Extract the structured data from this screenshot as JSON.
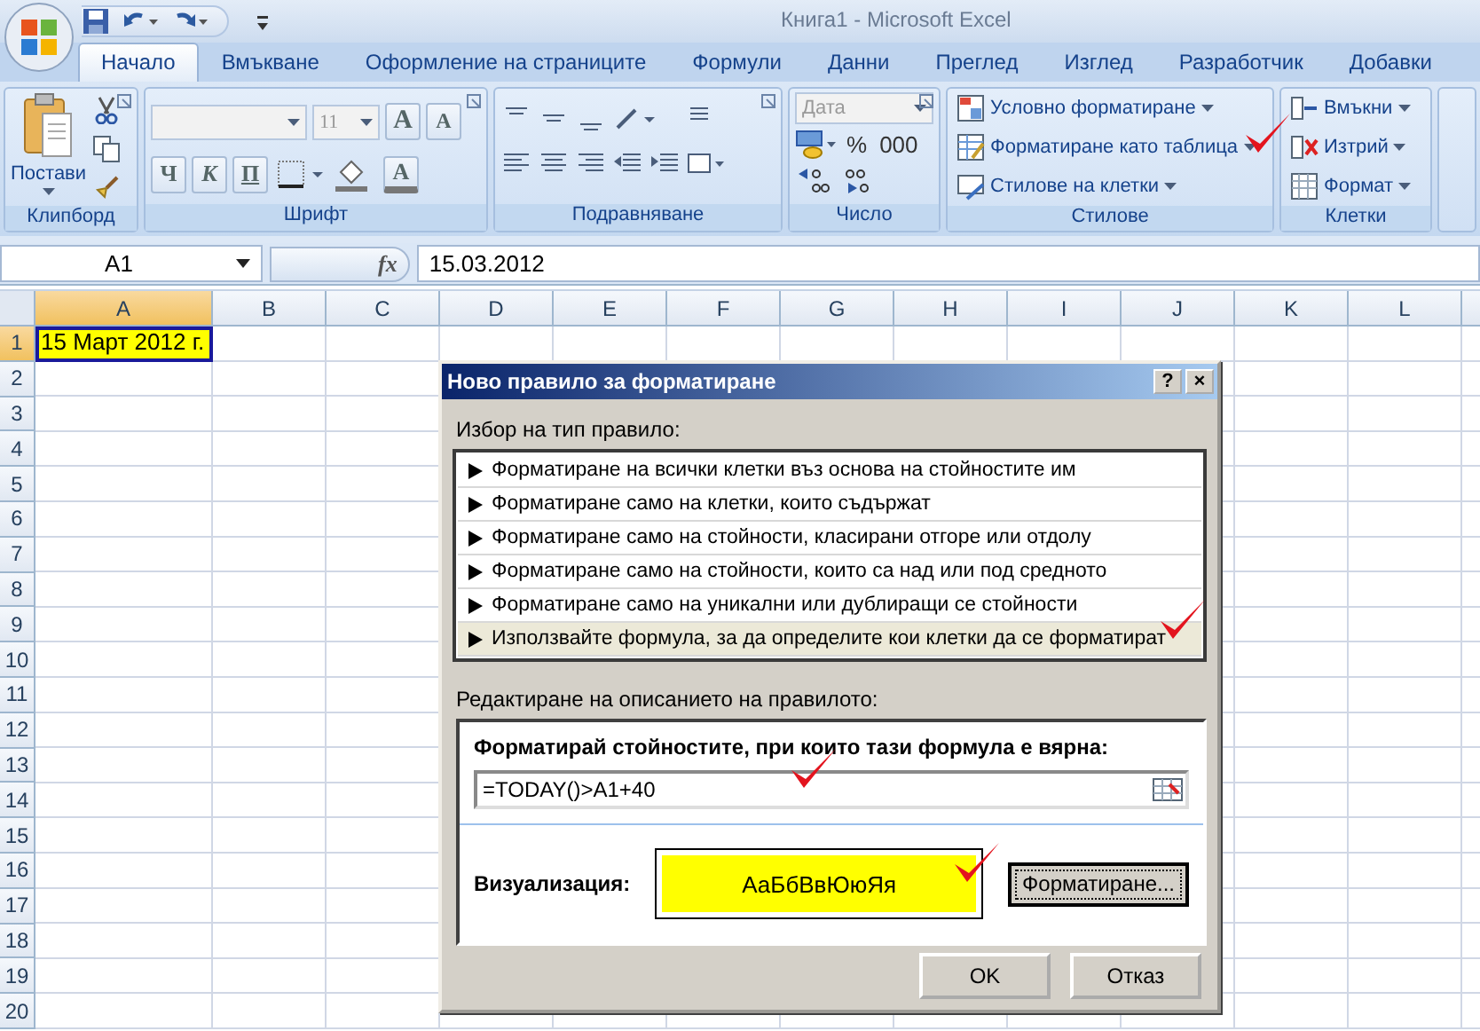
{
  "title_bar": {
    "title": "Книга1 - Microsoft Excel"
  },
  "tabs": [
    {
      "label": "Начало",
      "selected": true
    },
    {
      "label": "Вмъкване",
      "selected": false
    },
    {
      "label": "Оформление на страниците",
      "selected": false
    },
    {
      "label": "Формули",
      "selected": false
    },
    {
      "label": "Данни",
      "selected": false
    },
    {
      "label": "Преглед",
      "selected": false
    },
    {
      "label": "Изглед",
      "selected": false
    },
    {
      "label": "Разработчик",
      "selected": false
    },
    {
      "label": "Добавки",
      "selected": false
    }
  ],
  "ribbon": {
    "clipboard": {
      "label": "Клипборд",
      "paste": "Постави"
    },
    "font": {
      "label": "Шрифт",
      "size": "11",
      "size_buttons": [
        "A",
        "A"
      ],
      "style_buttons": [
        "Ч",
        "К",
        "П"
      ],
      "color_button": "A"
    },
    "alignment": {
      "label": "Подравняване"
    },
    "number": {
      "label": "Число",
      "format": "Дата",
      "buttons": [
        "%",
        "000"
      ]
    },
    "styles": {
      "label": "Стилове",
      "items": [
        "Условно форматиране",
        "Форматиране като таблица",
        "Стилове на клетки"
      ]
    },
    "cells": {
      "label": "Клетки",
      "items": [
        "Вмъкни",
        "Изтрий",
        "Формат"
      ]
    }
  },
  "formula_bar": {
    "name_box": "A1",
    "function_label": "fx",
    "value": "15.03.2012"
  },
  "sheet": {
    "columns": [
      "A",
      "B",
      "C",
      "D",
      "E",
      "F",
      "G",
      "H",
      "I",
      "J",
      "K",
      "L"
    ],
    "rows": [
      "1",
      "2",
      "3",
      "4",
      "5",
      "6",
      "7",
      "8",
      "9",
      "10",
      "11",
      "12",
      "13",
      "14",
      "15",
      "16",
      "17",
      "18",
      "19",
      "20"
    ],
    "active_cell": {
      "value": "15 Март 2012 г.",
      "selected": true
    }
  },
  "dialog": {
    "title": "Ново правило за форматиране",
    "help_button": "?",
    "close_button": "×",
    "rule_type_label": "Избор на тип правило:",
    "rule_types": [
      {
        "label": "Форматиране на всички клетки въз основа на стойностите им",
        "selected": false
      },
      {
        "label": "Форматиране само на клетки, които съдържат",
        "selected": false
      },
      {
        "label": "Форматиране само на стойности, класирани отгоре или отдолу",
        "selected": false
      },
      {
        "label": "Форматиране само на стойности, които са над или под средното",
        "selected": false
      },
      {
        "label": "Форматиране само на уникални или дублиращи се стойности",
        "selected": false
      },
      {
        "label": "Използвайте формула, за да определите кои клетки да се форматират",
        "selected": true
      }
    ],
    "edit_label": "Редактиране на описанието на правилото:",
    "formula_label": "Форматирай стойностите, при които тази формула е вярна:",
    "formula": "=TODAY()>A1+40",
    "preview_label": "Визуализация:",
    "preview_text": "АаБбВвЮюЯя",
    "format_button": "Форматиране...",
    "ok_button": "OK",
    "cancel_button": "Отказ"
  }
}
